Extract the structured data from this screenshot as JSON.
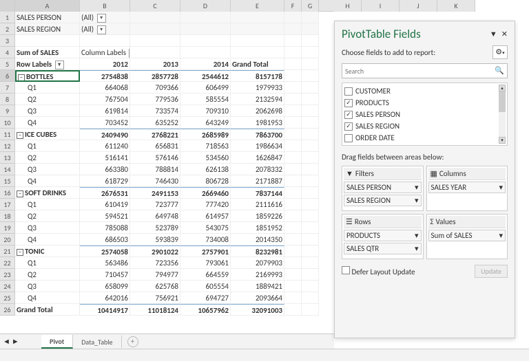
{
  "columns": [
    "A",
    "B",
    "C",
    "D",
    "E",
    "F",
    "G",
    "H",
    "I",
    "J",
    "K"
  ],
  "filters": [
    {
      "label": "SALES PERSON",
      "value": "(All)"
    },
    {
      "label": "SALES REGION",
      "value": "(All)"
    }
  ],
  "measure": "Sum of SALES",
  "colLabel": "Column Labels",
  "rowLabel": "Row Labels",
  "years": [
    "2012",
    "2013",
    "2014",
    "Grand Total"
  ],
  "groups": [
    {
      "name": "BOTTLES",
      "tot": [
        "2754838",
        "2857728",
        "2544612",
        "8157178"
      ],
      "rows": [
        [
          "Q1",
          "664068",
          "709366",
          "606499",
          "1979933"
        ],
        [
          "Q2",
          "767504",
          "779536",
          "585554",
          "2132594"
        ],
        [
          "Q3",
          "619814",
          "733574",
          "709310",
          "2062698"
        ],
        [
          "Q4",
          "703452",
          "635252",
          "643249",
          "1981953"
        ]
      ]
    },
    {
      "name": "ICE CUBES",
      "tot": [
        "2409490",
        "2768221",
        "2685989",
        "7863700"
      ],
      "rows": [
        [
          "Q1",
          "611240",
          "656831",
          "718563",
          "1986634"
        ],
        [
          "Q2",
          "516141",
          "576146",
          "534560",
          "1626847"
        ],
        [
          "Q3",
          "663380",
          "788814",
          "626138",
          "2078332"
        ],
        [
          "Q4",
          "618729",
          "746430",
          "806728",
          "2171887"
        ]
      ]
    },
    {
      "name": "SOFT DRINKS",
      "tot": [
        "2676531",
        "2491153",
        "2669460",
        "7837144"
      ],
      "rows": [
        [
          "Q1",
          "610419",
          "723777",
          "777420",
          "2111616"
        ],
        [
          "Q2",
          "594521",
          "649748",
          "614957",
          "1859226"
        ],
        [
          "Q3",
          "785088",
          "523789",
          "543075",
          "1851952"
        ],
        [
          "Q4",
          "686503",
          "593839",
          "734008",
          "2014350"
        ]
      ]
    },
    {
      "name": "TONIC",
      "tot": [
        "2574058",
        "2901022",
        "2757901",
        "8232981"
      ],
      "rows": [
        [
          "Q1",
          "563486",
          "723356",
          "793061",
          "2079903"
        ],
        [
          "Q2",
          "710457",
          "794977",
          "664559",
          "2169993"
        ],
        [
          "Q3",
          "658099",
          "625768",
          "605554",
          "1889421"
        ],
        [
          "Q4",
          "642016",
          "756921",
          "694727",
          "2093664"
        ]
      ]
    }
  ],
  "grandTotal": [
    "Grand Total",
    "10414917",
    "11018124",
    "10657962",
    "32091003"
  ],
  "tabs": {
    "active": "Pivot",
    "other": "Data_Table"
  },
  "panel": {
    "title": "PivotTable Fields",
    "sub": "Choose fields to add to report:",
    "search": "Search",
    "fields": [
      {
        "name": "CUSTOMER",
        "checked": false
      },
      {
        "name": "PRODUCTS",
        "checked": true
      },
      {
        "name": "SALES PERSON",
        "checked": true
      },
      {
        "name": "SALES REGION",
        "checked": true
      },
      {
        "name": "ORDER DATE",
        "checked": false
      }
    ],
    "drag": "Drag fields between areas below:",
    "areaFilters": "Filters",
    "areaCols": "Columns",
    "areaRows": "Rows",
    "areaVals": "Values",
    "filterItems": [
      "SALES PERSON",
      "SALES REGION"
    ],
    "colItems": [
      "SALES YEAR"
    ],
    "rowItems": [
      "PRODUCTS",
      "SALES QTR"
    ],
    "valItems": [
      "Sum of SALES"
    ],
    "defer": "Defer Layout Update",
    "update": "Update"
  },
  "chart_data": {
    "type": "table",
    "title": "Sum of SALES by PRODUCTS × SALES QTR × SALES YEAR",
    "columns": [
      "2012",
      "2013",
      "2014",
      "Grand Total"
    ],
    "rows": [
      {
        "product": "BOTTLES",
        "qtr": "Q1",
        "values": [
          664068,
          709366,
          606499,
          1979933
        ]
      },
      {
        "product": "BOTTLES",
        "qtr": "Q2",
        "values": [
          767504,
          779536,
          585554,
          2132594
        ]
      },
      {
        "product": "BOTTLES",
        "qtr": "Q3",
        "values": [
          619814,
          733574,
          709310,
          2062698
        ]
      },
      {
        "product": "BOTTLES",
        "qtr": "Q4",
        "values": [
          703452,
          635252,
          643249,
          1981953
        ]
      },
      {
        "product": "BOTTLES",
        "qtr": "Total",
        "values": [
          2754838,
          2857728,
          2544612,
          8157178
        ]
      },
      {
        "product": "ICE CUBES",
        "qtr": "Q1",
        "values": [
          611240,
          656831,
          718563,
          1986634
        ]
      },
      {
        "product": "ICE CUBES",
        "qtr": "Q2",
        "values": [
          516141,
          576146,
          534560,
          1626847
        ]
      },
      {
        "product": "ICE CUBES",
        "qtr": "Q3",
        "values": [
          663380,
          788814,
          626138,
          2078332
        ]
      },
      {
        "product": "ICE CUBES",
        "qtr": "Q4",
        "values": [
          618729,
          746430,
          806728,
          2171887
        ]
      },
      {
        "product": "ICE CUBES",
        "qtr": "Total",
        "values": [
          2409490,
          2768221,
          2685989,
          7863700
        ]
      },
      {
        "product": "SOFT DRINKS",
        "qtr": "Q1",
        "values": [
          610419,
          723777,
          777420,
          2111616
        ]
      },
      {
        "product": "SOFT DRINKS",
        "qtr": "Q2",
        "values": [
          594521,
          649748,
          614957,
          1859226
        ]
      },
      {
        "product": "SOFT DRINKS",
        "qtr": "Q3",
        "values": [
          785088,
          523789,
          543075,
          1851952
        ]
      },
      {
        "product": "SOFT DRINKS",
        "qtr": "Q4",
        "values": [
          686503,
          593839,
          734008,
          2014350
        ]
      },
      {
        "product": "SOFT DRINKS",
        "qtr": "Total",
        "values": [
          2676531,
          2491153,
          2669460,
          7837144
        ]
      },
      {
        "product": "TONIC",
        "qtr": "Q1",
        "values": [
          563486,
          723356,
          793061,
          2079903
        ]
      },
      {
        "product": "TONIC",
        "qtr": "Q2",
        "values": [
          710457,
          794977,
          664559,
          2169993
        ]
      },
      {
        "product": "TONIC",
        "qtr": "Q3",
        "values": [
          658099,
          625768,
          605554,
          1889421
        ]
      },
      {
        "product": "TONIC",
        "qtr": "Q4",
        "values": [
          642016,
          756921,
          694727,
          2093664
        ]
      },
      {
        "product": "TONIC",
        "qtr": "Total",
        "values": [
          2574058,
          2901022,
          2757901,
          8232981
        ]
      },
      {
        "product": "Grand Total",
        "qtr": "",
        "values": [
          10414917,
          11018124,
          10657962,
          32091003
        ]
      }
    ]
  }
}
